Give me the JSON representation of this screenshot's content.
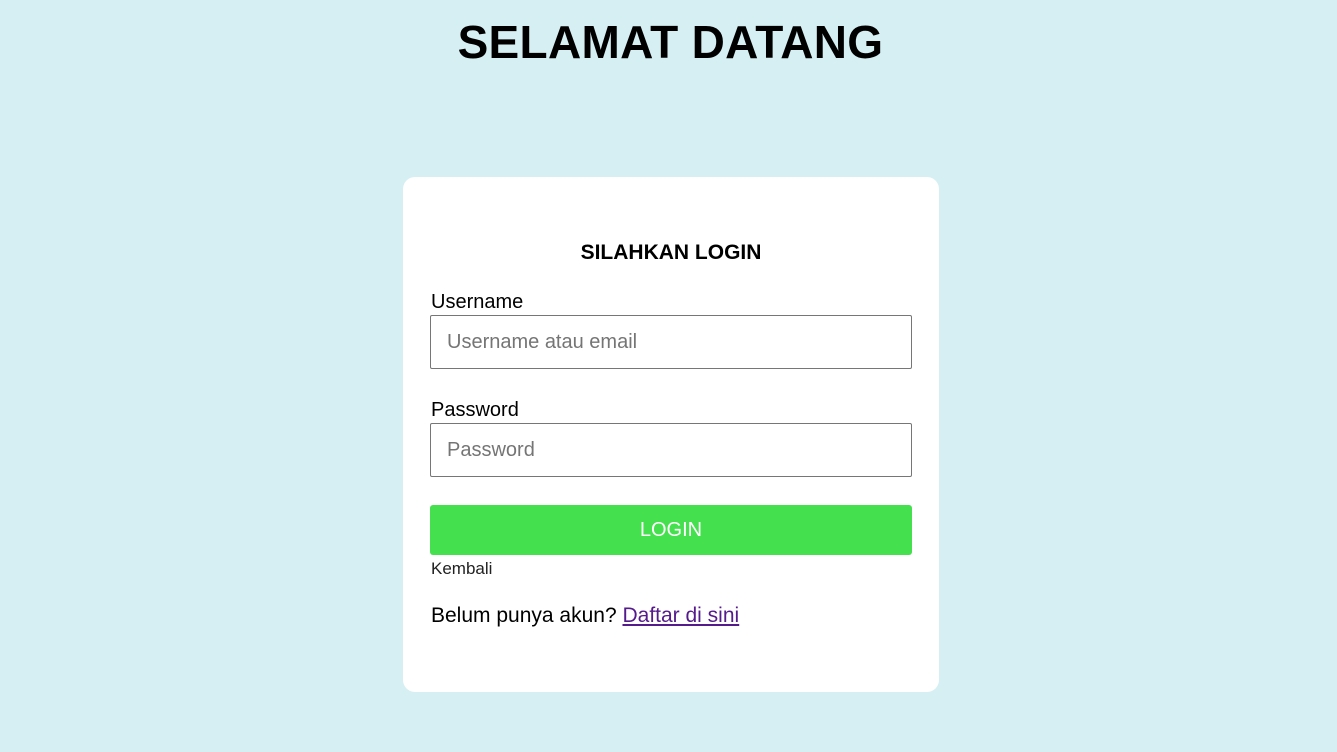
{
  "header": {
    "title": "SELAMAT DATANG"
  },
  "login_card": {
    "title": "SILAHKAN LOGIN",
    "username": {
      "label": "Username",
      "value": "",
      "placeholder": "Username atau email"
    },
    "password": {
      "label": "Password",
      "value": "",
      "placeholder": "Password"
    },
    "login_button_label": "LOGIN",
    "back_link_label": "Kembali",
    "register_prompt": "Belum punya akun?",
    "register_link_label": "Daftar di sini"
  },
  "colors": {
    "background": "#d5eff3",
    "card": "#ffffff",
    "login_button": "#44e04e",
    "link_visited": "#551a8b"
  }
}
